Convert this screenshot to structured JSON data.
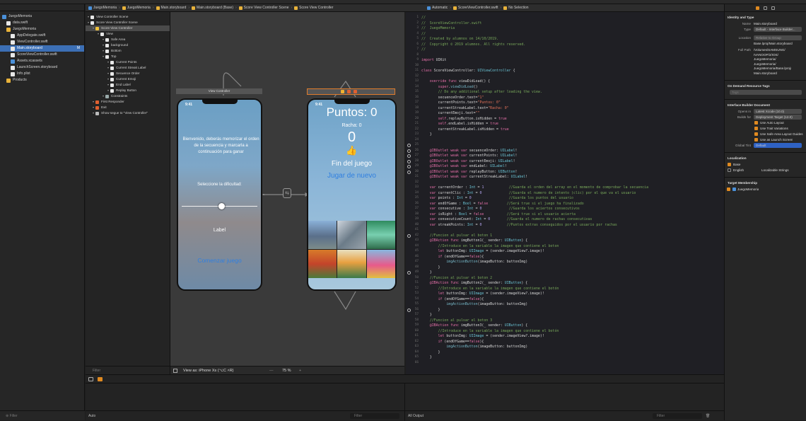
{
  "navigator": {
    "items": [
      {
        "label": "JuegoMemoria",
        "indent": 0,
        "icon": "project-icon",
        "color": "#4a90d9"
      },
      {
        "label": "data.swift",
        "indent": 1,
        "icon": "swift-file-icon",
        "color": "#e8e8e8"
      },
      {
        "label": "JuegoMemoria",
        "indent": 1,
        "icon": "folder-icon",
        "color": "#e8b23a"
      },
      {
        "label": "AppDelegate.swift",
        "indent": 2,
        "icon": "swift-file-icon",
        "color": "#e8e8e8"
      },
      {
        "label": "ViewController.swift",
        "indent": 2,
        "icon": "swift-file-icon",
        "color": "#e8e8e8"
      },
      {
        "label": "Main.storyboard",
        "indent": 2,
        "icon": "storyboard-icon",
        "color": "#e8e8e8",
        "selected": true,
        "badge": "M"
      },
      {
        "label": "ScoreViewController.swift",
        "indent": 2,
        "icon": "swift-file-icon",
        "color": "#e8e8e8"
      },
      {
        "label": "Assets.xcassets",
        "indent": 2,
        "icon": "assets-icon",
        "color": "#4a90d9"
      },
      {
        "label": "LaunchScreen.storyboard",
        "indent": 2,
        "icon": "storyboard-icon",
        "color": "#e8e8e8"
      },
      {
        "label": "Info.plist",
        "indent": 2,
        "icon": "plist-icon",
        "color": "#e8e8e8"
      },
      {
        "label": "Products",
        "indent": 1,
        "icon": "folder-icon",
        "color": "#e8b23a"
      }
    ],
    "filter_placeholder": "Filter"
  },
  "storyboard_jumpbar": [
    "JuegoMemoria",
    "JuegoMemoria",
    "Main.storyboard",
    "Main.storyboard (Base)",
    "Score View Controller Scene",
    "Score View Controller"
  ],
  "editor_jumpbar": [
    "Automatic",
    "ScoreViewController.swift",
    "No Selection"
  ],
  "outline": {
    "items": [
      {
        "label": "View Controller Scene",
        "indent": 0,
        "color": "#e8e8e8"
      },
      {
        "label": "Score View Controller Scene",
        "indent": 0,
        "color": "#e8e8e8"
      },
      {
        "label": "Score View Controller",
        "indent": 1,
        "color": "#f0c23a",
        "selected": true
      },
      {
        "label": "View",
        "indent": 2,
        "color": "#e8e8e8"
      },
      {
        "label": "Safe Area",
        "indent": 3,
        "color": "#e8e8e8"
      },
      {
        "label": "background",
        "indent": 3,
        "color": "#e8e8e8"
      },
      {
        "label": "Bottom",
        "indent": 3,
        "color": "#e8e8e8"
      },
      {
        "label": "Top",
        "indent": 3,
        "color": "#e8e8e8"
      },
      {
        "label": "Current Points",
        "indent": 4,
        "color": "#e8e8e8"
      },
      {
        "label": "Current Streak Label",
        "indent": 4,
        "color": "#e8e8e8"
      },
      {
        "label": "Secuence Order",
        "indent": 4,
        "color": "#e8e8e8"
      },
      {
        "label": "Current Emoji",
        "indent": 4,
        "color": "#e8e8e8"
      },
      {
        "label": "End Label",
        "indent": 4,
        "color": "#e8e8e8"
      },
      {
        "label": "Replay Button",
        "indent": 4,
        "color": "#e8e8e8"
      },
      {
        "label": "Constraints",
        "indent": 3,
        "color": "#9aa"
      },
      {
        "label": "First Responder",
        "indent": 1,
        "color": "#e06030"
      },
      {
        "label": "Exit",
        "indent": 1,
        "color": "#e06030"
      },
      {
        "label": "Show segue to \"View Controller\"",
        "indent": 1,
        "color": "#bbb"
      }
    ],
    "filter_placeholder": "Filter"
  },
  "canvas": {
    "vc_title": "View Controller",
    "phone1": {
      "time": "9:41",
      "intro": "Bienvenido, deberás memorizar el orden de la secuencia y marcarla a continuación para ganar",
      "difficulty_label": "Seleccione la dificultad:",
      "label": "Label",
      "start_button": "Comenzar juego"
    },
    "phone2": {
      "time": "9:41",
      "points": "Puntos: 0",
      "streak": "Racha: 0",
      "order": "0",
      "emoji": "👍",
      "end_label": "Fin del juego",
      "replay_button": "Jugar de nuevo"
    },
    "segue_label": "Show",
    "view_as": "View as: iPhone Xs (⌥C ˄R)",
    "zoom": "75 %"
  },
  "code_lines": [
    [
      [
        "c",
        "//"
      ]
    ],
    [
      [
        "c",
        "//  ScoreViewController.swift"
      ]
    ],
    [
      [
        "c",
        "//  JuegoMemoria"
      ]
    ],
    [
      [
        "c",
        "//"
      ]
    ],
    [
      [
        "c",
        "//  Created by alumnos on 14/10/2019."
      ]
    ],
    [
      [
        "c",
        "//  Copyright © 2019 alumnos. All rights reserved."
      ]
    ],
    [
      [
        "c",
        "//"
      ]
    ],
    [],
    [
      [
        "k",
        "import"
      ],
      [
        "t",
        " UIKit"
      ]
    ],
    [],
    [
      [
        "k",
        "class"
      ],
      [
        "t",
        " ScoreViewController: "
      ],
      [
        "y",
        "UIViewController"
      ],
      [
        "t",
        " {"
      ]
    ],
    [],
    [
      [
        "t",
        "    "
      ],
      [
        "k",
        "override func"
      ],
      [
        "t",
        " viewDidLoad() {"
      ]
    ],
    [
      [
        "t",
        "        "
      ],
      [
        "k",
        "super"
      ],
      [
        "t",
        "."
      ],
      [
        "f",
        "viewDidLoad"
      ],
      [
        "t",
        "()"
      ]
    ],
    [
      [
        "t",
        "        "
      ],
      [
        "c",
        "// Do any additional setup after loading the view."
      ]
    ],
    [
      [
        "t",
        "        secuenceOrder.text="
      ],
      [
        "s",
        "\"1\""
      ]
    ],
    [
      [
        "t",
        "        currentPoints.text="
      ],
      [
        "s",
        "\"Puntos: 0\""
      ]
    ],
    [
      [
        "t",
        "        currentStreakLabel.text="
      ],
      [
        "s",
        "\"Racha: 0\""
      ]
    ],
    [
      [
        "t",
        "        currentEmoji.text="
      ],
      [
        "s",
        "\"\""
      ]
    ],
    [
      [
        "t",
        "        "
      ],
      [
        "k",
        "self"
      ],
      [
        "t",
        ".replayButton.isHidden = "
      ],
      [
        "k",
        "true"
      ]
    ],
    [
      [
        "t",
        "        "
      ],
      [
        "k",
        "self"
      ],
      [
        "t",
        ".endLabel.isHidden = "
      ],
      [
        "k",
        "true"
      ]
    ],
    [
      [
        "t",
        "        currentStreakLabel.isHidden = "
      ],
      [
        "k",
        "true"
      ]
    ],
    [
      [
        "t",
        "    }"
      ]
    ],
    [],
    [],
    [
      [
        "t",
        "    "
      ],
      [
        "k",
        "@IBOutlet weak var"
      ],
      [
        "t",
        " secuenceOrder: "
      ],
      [
        "y",
        "UILabel"
      ],
      [
        "t",
        "!"
      ]
    ],
    [
      [
        "t",
        "    "
      ],
      [
        "k",
        "@IBOutlet weak var"
      ],
      [
        "t",
        " currentPoints: "
      ],
      [
        "y",
        "UILabel"
      ],
      [
        "t",
        "!"
      ]
    ],
    [
      [
        "t",
        "    "
      ],
      [
        "k",
        "@IBOutlet weak var"
      ],
      [
        "t",
        " currentEmoji: "
      ],
      [
        "y",
        "UILabel"
      ],
      [
        "t",
        "!"
      ]
    ],
    [
      [
        "t",
        "    "
      ],
      [
        "k",
        "@IBOutlet weak var"
      ],
      [
        "t",
        " endLabel: "
      ],
      [
        "y",
        "UILabel"
      ],
      [
        "t",
        "!"
      ]
    ],
    [
      [
        "t",
        "    "
      ],
      [
        "k",
        "@IBOutlet weak var"
      ],
      [
        "t",
        " replayButton: "
      ],
      [
        "y",
        "UIButton"
      ],
      [
        "t",
        "!"
      ]
    ],
    [
      [
        "t",
        "    "
      ],
      [
        "k",
        "@IBOutlet weak var"
      ],
      [
        "t",
        " currentStreakLabel: "
      ],
      [
        "y",
        "UILabel"
      ],
      [
        "t",
        "!"
      ]
    ],
    [],
    [
      [
        "t",
        "    "
      ],
      [
        "k",
        "var"
      ],
      [
        "t",
        " currentOrder : "
      ],
      [
        "y",
        "Int"
      ],
      [
        "t",
        " = "
      ],
      [
        "n",
        "1"
      ],
      [
        "t",
        "            "
      ],
      [
        "c",
        "//Guarda el orden del array en el momento de comprobar la secuencia"
      ]
    ],
    [
      [
        "t",
        "    "
      ],
      [
        "k",
        "var"
      ],
      [
        "t",
        " currentClic : "
      ],
      [
        "y",
        "Int"
      ],
      [
        "t",
        " = "
      ],
      [
        "n",
        "0"
      ],
      [
        "t",
        "             "
      ],
      [
        "c",
        "//Guarda el numero de intento (clic) por el que va el usuario"
      ]
    ],
    [
      [
        "t",
        "    "
      ],
      [
        "k",
        "var"
      ],
      [
        "t",
        " points : "
      ],
      [
        "y",
        "Int"
      ],
      [
        "t",
        " = "
      ],
      [
        "n",
        "0"
      ],
      [
        "t",
        "                  "
      ],
      [
        "c",
        "//Guarda los puntos del usuario"
      ]
    ],
    [
      [
        "t",
        "    "
      ],
      [
        "k",
        "var"
      ],
      [
        "t",
        " endOfGame : "
      ],
      [
        "y",
        "Bool"
      ],
      [
        "t",
        " = "
      ],
      [
        "k",
        "false"
      ],
      [
        "t",
        "         "
      ],
      [
        "c",
        "//Será true si el juego ha finalizado"
      ]
    ],
    [
      [
        "t",
        "    "
      ],
      [
        "k",
        "var"
      ],
      [
        "t",
        " consecutive : "
      ],
      [
        "y",
        "Int"
      ],
      [
        "t",
        " = "
      ],
      [
        "n",
        "0"
      ],
      [
        "t",
        "             "
      ],
      [
        "c",
        "//Guarda los aciertos consecutivos"
      ]
    ],
    [
      [
        "t",
        "    "
      ],
      [
        "k",
        "var"
      ],
      [
        "t",
        " isRight : "
      ],
      [
        "y",
        "Bool"
      ],
      [
        "t",
        " = "
      ],
      [
        "k",
        "false"
      ],
      [
        "t",
        "           "
      ],
      [
        "c",
        "//Será true si el usuario acierta"
      ]
    ],
    [
      [
        "t",
        "    "
      ],
      [
        "k",
        "var"
      ],
      [
        "t",
        " consecutiveCount: "
      ],
      [
        "y",
        "Int"
      ],
      [
        "t",
        " = "
      ],
      [
        "n",
        "0"
      ],
      [
        "t",
        "        "
      ],
      [
        "c",
        "//Guarda el numero de rachas consecutivas"
      ]
    ],
    [
      [
        "t",
        "    "
      ],
      [
        "k",
        "var"
      ],
      [
        "t",
        " streakPoints: "
      ],
      [
        "y",
        "Int"
      ],
      [
        "t",
        " = "
      ],
      [
        "n",
        "0"
      ],
      [
        "t",
        "            "
      ],
      [
        "c",
        "//Puntos extras conseguidos por el usuario por rachas"
      ]
    ],
    [],
    [
      [
        "t",
        "    "
      ],
      [
        "c",
        "//Funcion al pulsar el boton 1"
      ]
    ],
    [
      [
        "t",
        "    "
      ],
      [
        "k",
        "@IBAction func"
      ],
      [
        "t",
        " imgButton1(_ sender: "
      ],
      [
        "y",
        "UIButton"
      ],
      [
        "t",
        ") {"
      ]
    ],
    [
      [
        "t",
        "        "
      ],
      [
        "c",
        "//Introduce en la variable la imagen que contiene el boton"
      ]
    ],
    [
      [
        "t",
        "        "
      ],
      [
        "k",
        "let"
      ],
      [
        "t",
        " buttonImg: "
      ],
      [
        "y",
        "UIImage"
      ],
      [
        "t",
        " = (sender.imageView?.image)!"
      ]
    ],
    [
      [
        "t",
        "        "
      ],
      [
        "k",
        "if"
      ],
      [
        "t",
        " (endOfGame=="
      ],
      [
        "k",
        "false"
      ],
      [
        "t",
        "){"
      ]
    ],
    [
      [
        "t",
        "            "
      ],
      [
        "f",
        "imgActionButton"
      ],
      [
        "t",
        "(imageButton: buttonImg)"
      ]
    ],
    [
      [
        "t",
        "        }"
      ]
    ],
    [
      [
        "t",
        "    }"
      ]
    ],
    [
      [
        "t",
        "    "
      ],
      [
        "c",
        "//Funcion al pulsar el boton 2"
      ]
    ],
    [
      [
        "t",
        "    "
      ],
      [
        "k",
        "@IBAction func"
      ],
      [
        "t",
        " imgButton2(_ sender: "
      ],
      [
        "y",
        "UIButton"
      ],
      [
        "t",
        ") {"
      ]
    ],
    [
      [
        "t",
        "        "
      ],
      [
        "c",
        "//Introduce en la variable la imagen que contiene el botón"
      ]
    ],
    [
      [
        "t",
        "        "
      ],
      [
        "k",
        "let"
      ],
      [
        "t",
        " buttonImg: "
      ],
      [
        "y",
        "UIImage"
      ],
      [
        "t",
        " = (sender.imageView?.image)!"
      ]
    ],
    [
      [
        "t",
        "        "
      ],
      [
        "k",
        "if"
      ],
      [
        "t",
        " (endOfGame=="
      ],
      [
        "k",
        "false"
      ],
      [
        "t",
        "){"
      ]
    ],
    [
      [
        "t",
        "            "
      ],
      [
        "f",
        "imgActionButton"
      ],
      [
        "t",
        "(imageButton: buttonImg)"
      ]
    ],
    [
      [
        "t",
        "        }"
      ]
    ],
    [
      [
        "t",
        "    }"
      ]
    ],
    [
      [
        "t",
        "    "
      ],
      [
        "c",
        "//Funcion al pulsar el boton 3"
      ]
    ],
    [
      [
        "t",
        "    "
      ],
      [
        "k",
        "@IBAction func"
      ],
      [
        "t",
        " imgButton3(_ sender: "
      ],
      [
        "y",
        "UIButton"
      ],
      [
        "t",
        ") {"
      ]
    ],
    [
      [
        "t",
        "        "
      ],
      [
        "c",
        "//Introduce en la variable la imagen que contiene el botón"
      ]
    ],
    [
      [
        "t",
        "        "
      ],
      [
        "k",
        "let"
      ],
      [
        "t",
        " buttonImg: "
      ],
      [
        "y",
        "UIImage"
      ],
      [
        "t",
        " = (sender.imageView?.image)!"
      ]
    ],
    [
      [
        "t",
        "        "
      ],
      [
        "k",
        "if"
      ],
      [
        "t",
        " (endOfGame=="
      ],
      [
        "k",
        "false"
      ],
      [
        "t",
        "){"
      ]
    ],
    [
      [
        "t",
        "            "
      ],
      [
        "f",
        "imgActionButton"
      ],
      [
        "t",
        "(imageButton: buttonImg)"
      ]
    ],
    [
      [
        "t",
        "        }"
      ]
    ],
    [
      [
        "t",
        "    }"
      ]
    ],
    []
  ],
  "outlet_lines": [
    25,
    26,
    27,
    28,
    29,
    30,
    42,
    49,
    56
  ],
  "code_colors": {
    "c": "#79a95b",
    "k": "#e46fa8",
    "t": "#d8d8d8",
    "y": "#6bc5d6",
    "s": "#e8735a",
    "n": "#b4a4f0",
    "f": "#76b8c8"
  },
  "inspector": {
    "identity_title": "Identity and Type",
    "name_label": "Name",
    "name_value": "Main.storyboard",
    "type_label": "Type",
    "type_value": "Default - Interface Builder...",
    "location_label": "Location",
    "location_value": "Relative to Group",
    "location_file": "Base.lproj/Main.storyboard",
    "fullpath_label": "Full Path",
    "fullpath_value": [
      "/Volumes/SAMSUNG/",
      "IVANOOP/2/IOS/",
      "JuegoMemoria/",
      "JuegoMemoria/",
      "JuegoMemoria/Base.lproj/",
      "Main.storyboard"
    ],
    "odr_title": "On Demand Resource Tags",
    "tags_placeholder": "Tags",
    "ib_title": "Interface Builder Document",
    "opens_label": "Opens in",
    "opens_value": "Latest Xcode (10.0)",
    "builds_label": "Builds for",
    "builds_value": "Deployment Target (12.0)",
    "checks": [
      "Use Auto Layout",
      "Use Trait Variations",
      "Use Safe Area Layout Guides",
      "Use as Launch Screen"
    ],
    "tint_label": "Global Tint",
    "tint_value": "Default",
    "loc_title": "Localization",
    "loc_items": [
      {
        "label": "Base",
        "value": ""
      },
      {
        "label": "English",
        "value": "Localizable Strings"
      }
    ],
    "target_title": "Target Membership",
    "target_item": "JuegoMemoria"
  },
  "debug": {
    "auto_label": "Auto",
    "filter_placeholder": "Filter",
    "output_label": "All Output",
    "console_filter": "Filter"
  }
}
